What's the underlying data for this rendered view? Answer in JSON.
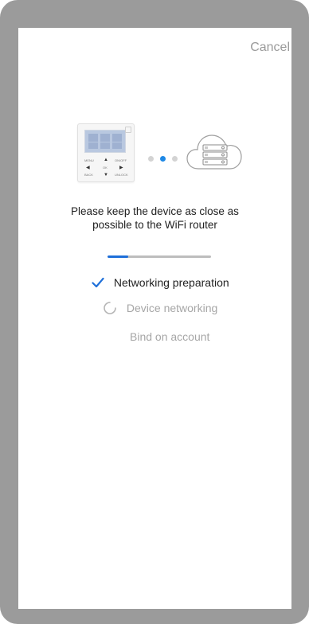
{
  "header": {
    "cancel_label": "Cancel"
  },
  "illustration": {
    "controller_keys": {
      "menu": "MENU",
      "on_off": "ON/OFF",
      "back": "BACK",
      "ok": "OK",
      "unlock": "UNLOCK"
    },
    "pairing_dots": [
      {
        "state": "inactive"
      },
      {
        "state": "active"
      },
      {
        "state": "inactive"
      }
    ],
    "accent_color": "#1e88e5"
  },
  "message": {
    "line1": "Please keep the device as close as",
    "line2": "possible to the WiFi router"
  },
  "progress": {
    "fraction": 0.2
  },
  "steps": [
    {
      "label": "Networking preparation",
      "status": "done",
      "icon": "check-icon"
    },
    {
      "label": "Device networking",
      "status": "in-progress",
      "icon": "spinner-icon"
    },
    {
      "label": "Bind on account",
      "status": "pending",
      "icon": ""
    }
  ]
}
